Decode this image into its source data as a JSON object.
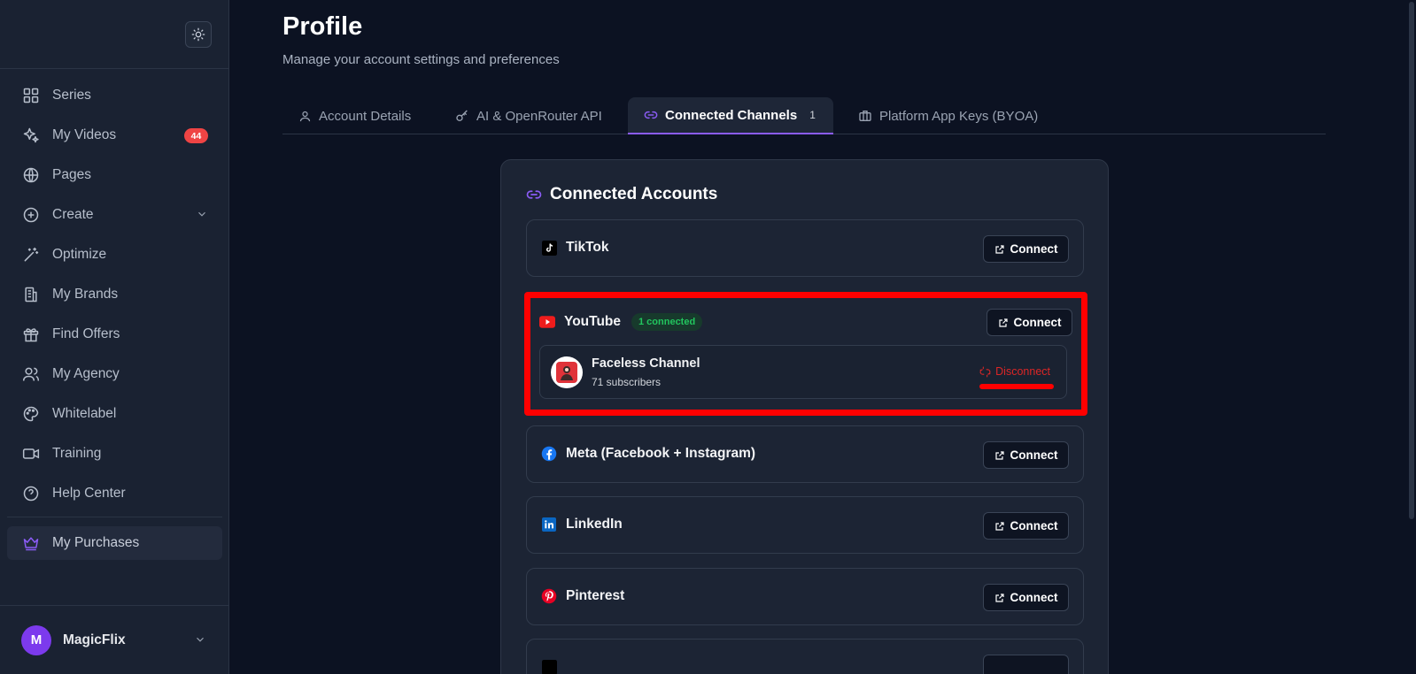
{
  "sidebar": {
    "items": [
      {
        "label": "Series",
        "icon": "grid-icon"
      },
      {
        "label": "My Videos",
        "icon": "sparkles-icon",
        "badge": "44"
      },
      {
        "label": "Pages",
        "icon": "globe-icon"
      },
      {
        "label": "Create",
        "icon": "plus-circle-icon"
      },
      {
        "label": "Optimize",
        "icon": "wand-icon"
      },
      {
        "label": "My Brands",
        "icon": "building-icon"
      },
      {
        "label": "Find Offers",
        "icon": "gift-icon"
      },
      {
        "label": "My Agency",
        "icon": "users-icon"
      },
      {
        "label": "Whitelabel",
        "icon": "palette-icon"
      },
      {
        "label": "Training",
        "icon": "video-icon"
      },
      {
        "label": "Help Center",
        "icon": "help-circle-icon"
      },
      {
        "label": "My Purchases",
        "icon": "crown-icon"
      }
    ],
    "user": {
      "initial": "M",
      "name": "MagicFlix"
    }
  },
  "page": {
    "title": "Profile",
    "subtitle": "Manage your account settings and preferences"
  },
  "tabs": [
    {
      "label": "Account Details"
    },
    {
      "label": "AI & OpenRouter API"
    },
    {
      "label": "Connected Channels",
      "count": "1"
    },
    {
      "label": "Platform App Keys (BYOA)"
    }
  ],
  "card": {
    "title": "Connected Accounts",
    "connect_label": "Connect",
    "platforms": [
      {
        "name": "TikTok"
      },
      {
        "name": "YouTube",
        "status": "1 connected"
      },
      {
        "name": "Meta (Facebook + Instagram)"
      },
      {
        "name": "LinkedIn"
      },
      {
        "name": "Pinterest"
      }
    ],
    "youtube_account": {
      "name": "Faceless Channel",
      "subscribers": "71 subscribers",
      "disconnect_label": "Disconnect"
    }
  },
  "colors": {
    "accent": "#8b5cf6",
    "highlight": "#ff0000",
    "success": "#22c55e",
    "danger": "#dc2626"
  }
}
